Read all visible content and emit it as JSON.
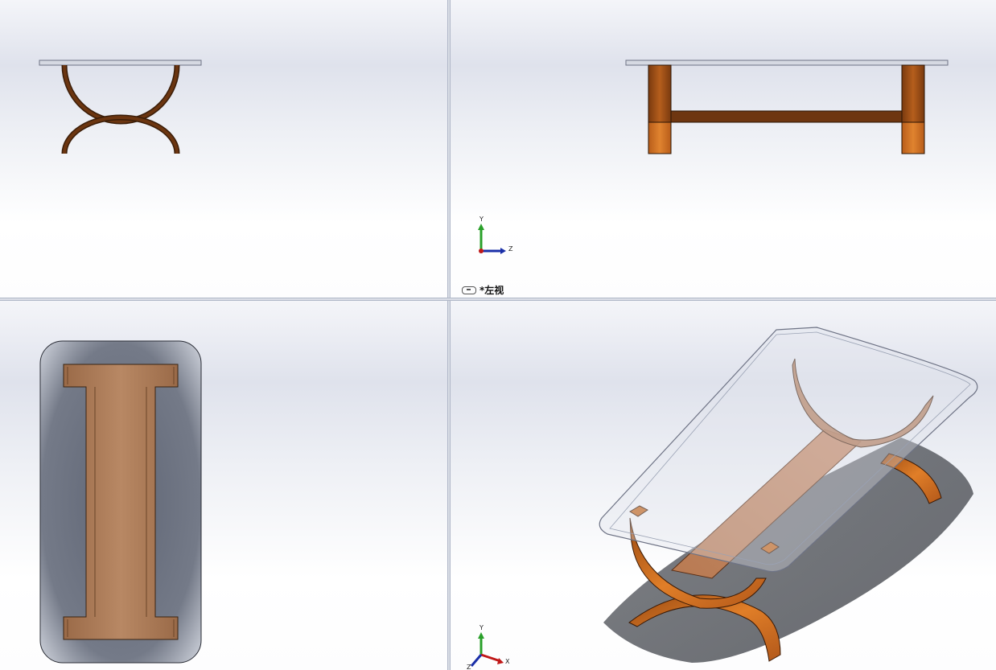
{
  "views": {
    "front": {
      "name": "front-view"
    },
    "left": {
      "name": "left-view",
      "label": "*左视"
    },
    "top": {
      "name": "top-view"
    },
    "iso": {
      "name": "isometric-view"
    }
  },
  "triad_left": {
    "y": "Y",
    "z": "Z"
  },
  "triad_iso": {
    "y": "Y",
    "x": "X",
    "z": "Z"
  },
  "colors": {
    "wood_dark": "#6b3510",
    "wood_mid": "#a8561a",
    "wood_light": "#d77a2a",
    "glass_edge": "#9aa2b4",
    "shadow": "#55585e"
  }
}
